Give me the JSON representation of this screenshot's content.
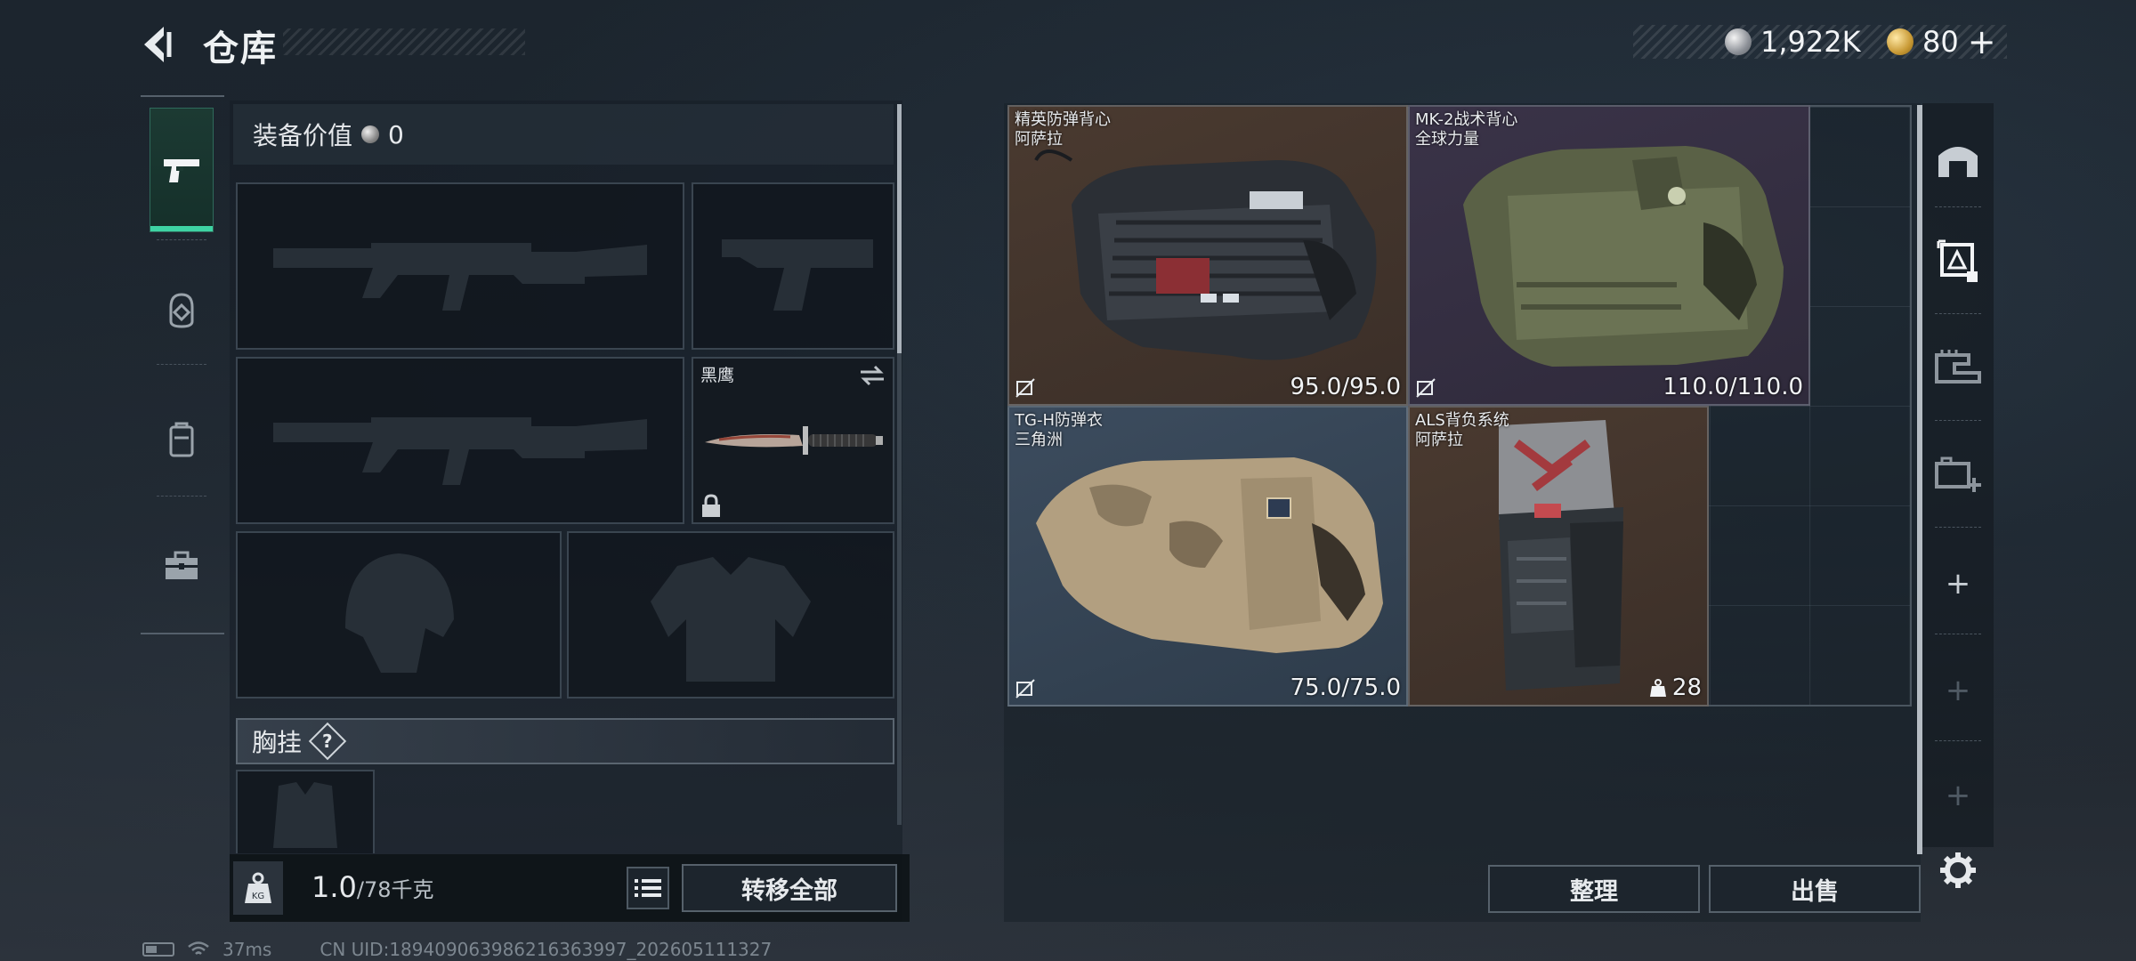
{
  "header": {
    "title": "仓库",
    "currency_primary": "1,922K",
    "currency_secondary": "80",
    "currency_add": "+"
  },
  "tabs": [
    {
      "name": "firearms",
      "icon": "pistol-icon",
      "active": true
    },
    {
      "name": "gear",
      "icon": "helmet-gear-icon",
      "active": false
    },
    {
      "name": "backpack",
      "icon": "backpack-icon",
      "active": false
    },
    {
      "name": "toolbox",
      "icon": "toolbox-icon",
      "active": false
    }
  ],
  "equipment": {
    "value_label": "装备价值",
    "value_amount": "0",
    "melee_slot_label": "黑鹰",
    "chest_rig_label": "胸挂",
    "help_symbol": "?"
  },
  "bottom_bar": {
    "weight_value": "1.0",
    "weight_capacity": "/78千克",
    "transfer_all": "转移全部"
  },
  "warehouse": {
    "items": [
      {
        "name": "精英防弹背心",
        "brand": "阿萨拉",
        "stat": "95.0/95.0",
        "rarity_color": "#4a3a30",
        "icon": "armor-vest-black-icon"
      },
      {
        "name": "MK-2战术背心",
        "brand": "全球力量",
        "stat": "110.0/110.0",
        "rarity_color": "#3a3348",
        "icon": "armor-vest-green-icon"
      },
      {
        "name": "TG-H防弹衣",
        "brand": "三角洲",
        "stat": "75.0/75.0",
        "rarity_color": "#3c4c5e",
        "icon": "armor-vest-camo-icon"
      },
      {
        "name": "ALS背负系统",
        "brand": "阿萨拉",
        "stat": "28",
        "rarity_color": "#4a3a30",
        "icon": "backpack-rig-icon"
      }
    ],
    "organize": "整理",
    "sell": "出售"
  },
  "right_rail": {
    "plus": "+"
  },
  "status": {
    "ping": "37ms",
    "uid": "CN UID:18940906398621636399​7_202605111327"
  }
}
